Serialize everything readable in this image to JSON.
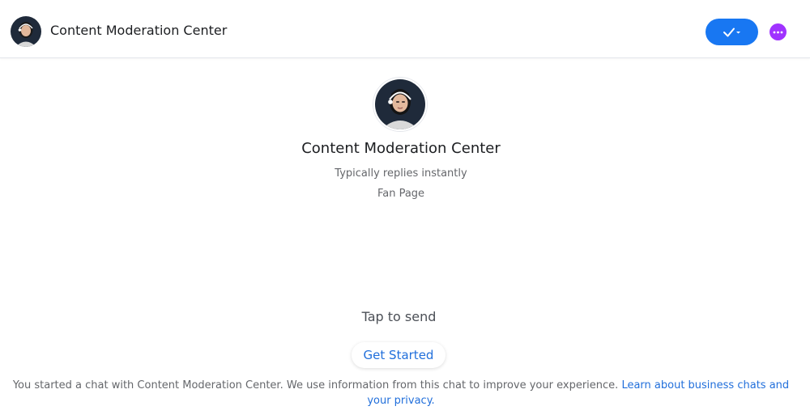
{
  "header": {
    "title": "Content Moderation Center",
    "check_icon": "check-dropdown-icon",
    "more_icon": "more-dots-icon"
  },
  "profile": {
    "name": "Content Moderation Center",
    "reply_time": "Typically replies instantly",
    "category": "Fan Page",
    "avatar_icon": "avatar-woman-headset"
  },
  "composer": {
    "tap_to_send": "Tap to send",
    "get_started_label": "Get Started"
  },
  "footer": {
    "disclaimer_text": "You started a chat with Content Moderation Center. We use information from this chat to improve your experience.",
    "learn_more_link": "Learn about business chats and your privacy."
  },
  "colors": {
    "accent_blue": "#1877f2",
    "link_blue": "#216fdb",
    "more_purple": "#a033ff",
    "divider": "#e4e6eb",
    "secondary_text": "#65676b"
  }
}
